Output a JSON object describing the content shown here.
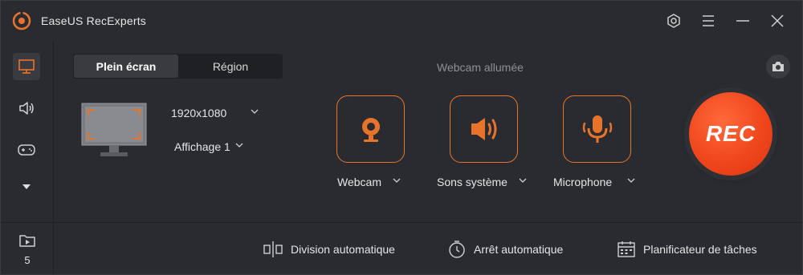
{
  "app": {
    "title": "EaseUS RecExperts",
    "brand_color": "#e8742c",
    "rec_color": "#f0461d"
  },
  "window_controls": [
    {
      "name": "settings-icon"
    },
    {
      "name": "menu-icon"
    },
    {
      "name": "minimize-icon"
    },
    {
      "name": "close-icon"
    }
  ],
  "sidebar": {
    "items": [
      {
        "name": "screen-record",
        "icon": "monitor-icon",
        "active": true
      },
      {
        "name": "audio-record",
        "icon": "speaker-icon",
        "active": false
      },
      {
        "name": "game-record",
        "icon": "gamepad-icon",
        "active": false
      },
      {
        "name": "more",
        "icon": "triangle-down-icon",
        "active": false
      }
    ],
    "files_count": "5"
  },
  "mode_tabs": {
    "full_screen": "Plein écran",
    "region": "Région"
  },
  "capture": {
    "resolution": "1920x1080",
    "display": "Affichage 1"
  },
  "webcam_status": "Webcam allumée",
  "sources": {
    "webcam": "Webcam",
    "system_sound": "Sons système",
    "microphone": "Microphone"
  },
  "rec_label": "REC",
  "bottom_toolbar": {
    "auto_split": "Division automatique",
    "auto_stop": "Arrêt automatique",
    "task_scheduler": "Planificateur de tâches"
  }
}
